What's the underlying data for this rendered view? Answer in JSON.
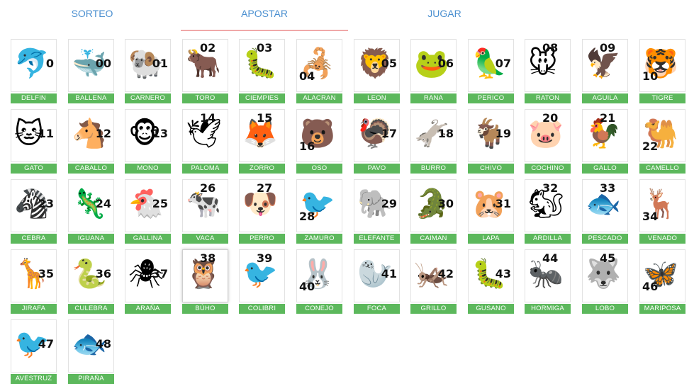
{
  "tabs": [
    {
      "label": "SORTEO"
    },
    {
      "label": "APOSTAR"
    },
    {
      "label": "JUGAR"
    }
  ],
  "active_tab": "APOSTAR",
  "animals": [
    {
      "name": "DELFIN",
      "num": "0",
      "icon": "dolphin-icon",
      "glyph": "🐬"
    },
    {
      "name": "BALLENA",
      "num": "00",
      "icon": "whale-icon",
      "glyph": "🐳"
    },
    {
      "name": "CARNERO",
      "num": "01",
      "icon": "ram-icon",
      "glyph": "🐏"
    },
    {
      "name": "TORO",
      "num": "02",
      "icon": "bull-icon",
      "glyph": "🐂"
    },
    {
      "name": "CIEMPIES",
      "num": "03",
      "icon": "centipede-icon",
      "glyph": "🐛"
    },
    {
      "name": "ALACRAN",
      "num": "04",
      "icon": "scorpion-icon",
      "glyph": "🦂"
    },
    {
      "name": "LEON",
      "num": "05",
      "icon": "lion-icon",
      "glyph": "🦁"
    },
    {
      "name": "RANA",
      "num": "06",
      "icon": "frog-icon",
      "glyph": "🐸"
    },
    {
      "name": "PERICO",
      "num": "07",
      "icon": "parrot-icon",
      "glyph": "🦜"
    },
    {
      "name": "RATON",
      "num": "08",
      "icon": "mouse-icon",
      "glyph": "🐭"
    },
    {
      "name": "AGUILA",
      "num": "09",
      "icon": "eagle-icon",
      "glyph": "🦅"
    },
    {
      "name": "TIGRE",
      "num": "10",
      "icon": "tiger-icon",
      "glyph": "🐯"
    },
    {
      "name": "GATO",
      "num": "11",
      "icon": "cat-icon",
      "glyph": "🐱"
    },
    {
      "name": "CABALLO",
      "num": "12",
      "icon": "horse-icon",
      "glyph": "🐴"
    },
    {
      "name": "MONO",
      "num": "13",
      "icon": "monkey-icon",
      "glyph": "🐵"
    },
    {
      "name": "PALOMA",
      "num": "14",
      "icon": "dove-icon",
      "glyph": "🕊"
    },
    {
      "name": "ZORRO",
      "num": "15",
      "icon": "fox-icon",
      "glyph": "🦊"
    },
    {
      "name": "OSO",
      "num": "16",
      "icon": "bear-icon",
      "glyph": "🐻"
    },
    {
      "name": "PAVO",
      "num": "17",
      "icon": "turkey-icon",
      "glyph": "🦃"
    },
    {
      "name": "BURRO",
      "num": "18",
      "icon": "donkey-icon",
      "glyph": "🫏"
    },
    {
      "name": "CHIVO",
      "num": "19",
      "icon": "goat-icon",
      "glyph": "🐐"
    },
    {
      "name": "COCHINO",
      "num": "20",
      "icon": "pig-icon",
      "glyph": "🐷"
    },
    {
      "name": "GALLO",
      "num": "21",
      "icon": "rooster-icon",
      "glyph": "🐓"
    },
    {
      "name": "CAMELLO",
      "num": "22",
      "icon": "camel-icon",
      "glyph": "🐫"
    },
    {
      "name": "CEBRA",
      "num": "23",
      "icon": "zebra-icon",
      "glyph": "🦓"
    },
    {
      "name": "IGUANA",
      "num": "24",
      "icon": "iguana-icon",
      "glyph": "🦎"
    },
    {
      "name": "GALLINA",
      "num": "25",
      "icon": "hen-icon",
      "glyph": "🐔"
    },
    {
      "name": "VACA",
      "num": "26",
      "icon": "cow-icon",
      "glyph": "🐄"
    },
    {
      "name": "PERRO",
      "num": "27",
      "icon": "dog-icon",
      "glyph": "🐶"
    },
    {
      "name": "ZAMURO",
      "num": "28",
      "icon": "vulture-icon",
      "glyph": "🐦"
    },
    {
      "name": "ELEFANTE",
      "num": "29",
      "icon": "elephant-icon",
      "glyph": "🐘"
    },
    {
      "name": "CAIMAN",
      "num": "30",
      "icon": "caiman-icon",
      "glyph": "🐊"
    },
    {
      "name": "LAPA",
      "num": "31",
      "icon": "paca-icon",
      "glyph": "🐹"
    },
    {
      "name": "ARDILLA",
      "num": "32",
      "icon": "squirrel-icon",
      "glyph": "🐿"
    },
    {
      "name": "PESCADO",
      "num": "33",
      "icon": "fish-icon",
      "glyph": "🐟"
    },
    {
      "name": "VENADO",
      "num": "34",
      "icon": "deer-icon",
      "glyph": "🦌"
    },
    {
      "name": "JIRAFA",
      "num": "35",
      "icon": "giraffe-icon",
      "glyph": "🦒"
    },
    {
      "name": "CULEBRA",
      "num": "36",
      "icon": "snake-icon",
      "glyph": "🐍"
    },
    {
      "name": "ARAÑA",
      "num": "37",
      "icon": "spider-icon",
      "glyph": "🕷"
    },
    {
      "name": "BÚHO",
      "num": "38",
      "icon": "owl-icon",
      "glyph": "🦉"
    },
    {
      "name": "COLIBRI",
      "num": "39",
      "icon": "hummingbird-icon",
      "glyph": "🐦"
    },
    {
      "name": "CONEJO",
      "num": "40",
      "icon": "rabbit-icon",
      "glyph": "🐰"
    },
    {
      "name": "FOCA",
      "num": "41",
      "icon": "seal-icon",
      "glyph": "🦭"
    },
    {
      "name": "GRILLO",
      "num": "42",
      "icon": "cricket-icon",
      "glyph": "🦗"
    },
    {
      "name": "GUSANO",
      "num": "43",
      "icon": "worm-icon",
      "glyph": "🐛"
    },
    {
      "name": "HORMIGA",
      "num": "44",
      "icon": "ant-icon",
      "glyph": "🐜"
    },
    {
      "name": "LOBO",
      "num": "45",
      "icon": "wolf-icon",
      "glyph": "🐺"
    },
    {
      "name": "MARIPOSA",
      "num": "46",
      "icon": "butterfly-icon",
      "glyph": "🦋"
    },
    {
      "name": "AVESTRUZ",
      "num": "47",
      "icon": "ostrich-icon",
      "glyph": "🐦"
    },
    {
      "name": "PIRAÑA",
      "num": "48",
      "icon": "piranha-icon",
      "glyph": "🐟"
    }
  ],
  "selected_animal": "BÚHO",
  "colors": {
    "tab_text": "#4a8fd0",
    "tab_underline": "#f0a8a8",
    "label_bg": "#5cb85c",
    "label_text": "#ffffff"
  }
}
